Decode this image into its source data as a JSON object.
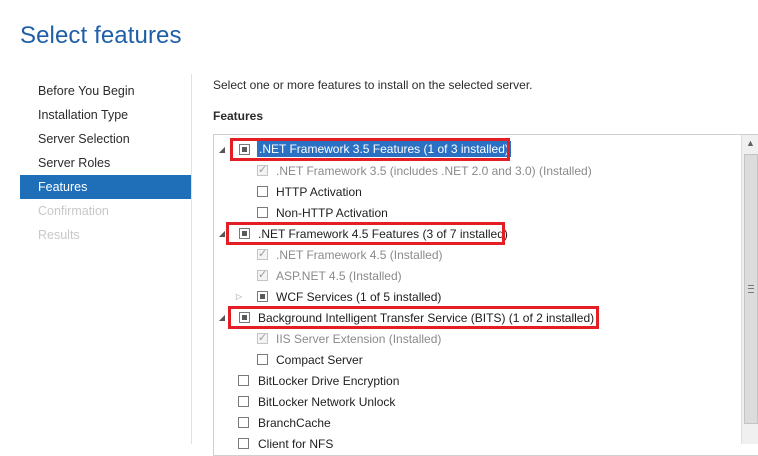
{
  "page": {
    "title": "Select features"
  },
  "nav": {
    "items": [
      {
        "label": "Before You Begin",
        "state": "normal"
      },
      {
        "label": "Installation Type",
        "state": "normal"
      },
      {
        "label": "Server Selection",
        "state": "normal"
      },
      {
        "label": "Server Roles",
        "state": "normal"
      },
      {
        "label": "Features",
        "state": "active"
      },
      {
        "label": "Confirmation",
        "state": "disabled"
      },
      {
        "label": "Results",
        "state": "disabled"
      }
    ]
  },
  "main": {
    "instruction": "Select one or more features to install on the selected server.",
    "features_heading": "Features"
  },
  "features": [
    {
      "label": ".NET Framework 3.5 Features (1 of 3 installed)",
      "state": "partial",
      "expander": "expanded",
      "selected": true,
      "highlighted": true
    },
    {
      "label": ".NET Framework 3.5 (includes .NET 2.0 and 3.0) (Installed)",
      "state": "installed"
    },
    {
      "label": "HTTP Activation",
      "state": "unchecked"
    },
    {
      "label": "Non-HTTP Activation",
      "state": "unchecked"
    },
    {
      "label": ".NET Framework 4.5 Features (3 of 7 installed)",
      "state": "partial",
      "expander": "expanded",
      "highlighted": true
    },
    {
      "label": ".NET Framework 4.5 (Installed)",
      "state": "installed"
    },
    {
      "label": "ASP.NET 4.5 (Installed)",
      "state": "installed"
    },
    {
      "label": "WCF Services (1 of 5 installed)",
      "state": "partial",
      "expander": "collapsed"
    },
    {
      "label": "Background Intelligent Transfer Service (BITS) (1 of 2 installed)",
      "state": "partial",
      "expander": "expanded",
      "highlighted": true
    },
    {
      "label": "IIS Server Extension (Installed)",
      "state": "installed"
    },
    {
      "label": "Compact Server",
      "state": "unchecked"
    },
    {
      "label": "BitLocker Drive Encryption",
      "state": "unchecked"
    },
    {
      "label": "BitLocker Network Unlock",
      "state": "unchecked"
    },
    {
      "label": "BranchCache",
      "state": "unchecked"
    },
    {
      "label": "Client for NFS",
      "state": "unchecked"
    }
  ],
  "colors": {
    "accent": "#1e6fb8",
    "title": "#1f5fa8",
    "highlight": "#e31e24"
  },
  "icons": {
    "expanded": "expanded-triangle-icon",
    "collapsed": "collapsed-triangle-icon"
  }
}
